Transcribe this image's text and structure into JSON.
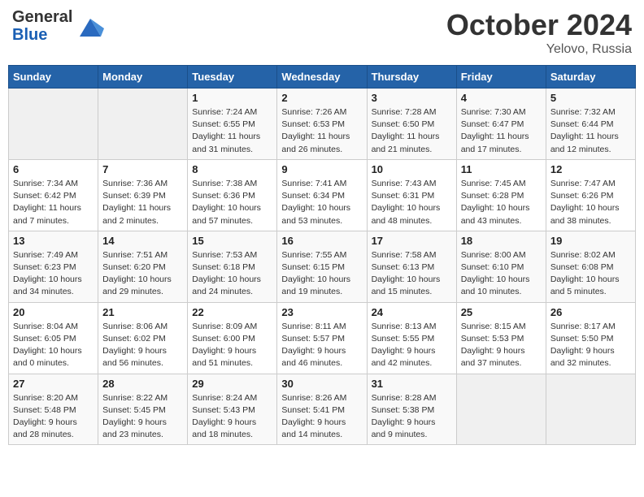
{
  "logo": {
    "line1": "General",
    "line2": "Blue"
  },
  "title": "October 2024",
  "subtitle": "Yelovo, Russia",
  "weekdays": [
    "Sunday",
    "Monday",
    "Tuesday",
    "Wednesday",
    "Thursday",
    "Friday",
    "Saturday"
  ],
  "weeks": [
    [
      {
        "day": "",
        "sunrise": "",
        "sunset": "",
        "daylight": ""
      },
      {
        "day": "",
        "sunrise": "",
        "sunset": "",
        "daylight": ""
      },
      {
        "day": "1",
        "sunrise": "Sunrise: 7:24 AM",
        "sunset": "Sunset: 6:55 PM",
        "daylight": "Daylight: 11 hours and 31 minutes."
      },
      {
        "day": "2",
        "sunrise": "Sunrise: 7:26 AM",
        "sunset": "Sunset: 6:53 PM",
        "daylight": "Daylight: 11 hours and 26 minutes."
      },
      {
        "day": "3",
        "sunrise": "Sunrise: 7:28 AM",
        "sunset": "Sunset: 6:50 PM",
        "daylight": "Daylight: 11 hours and 21 minutes."
      },
      {
        "day": "4",
        "sunrise": "Sunrise: 7:30 AM",
        "sunset": "Sunset: 6:47 PM",
        "daylight": "Daylight: 11 hours and 17 minutes."
      },
      {
        "day": "5",
        "sunrise": "Sunrise: 7:32 AM",
        "sunset": "Sunset: 6:44 PM",
        "daylight": "Daylight: 11 hours and 12 minutes."
      }
    ],
    [
      {
        "day": "6",
        "sunrise": "Sunrise: 7:34 AM",
        "sunset": "Sunset: 6:42 PM",
        "daylight": "Daylight: 11 hours and 7 minutes."
      },
      {
        "day": "7",
        "sunrise": "Sunrise: 7:36 AM",
        "sunset": "Sunset: 6:39 PM",
        "daylight": "Daylight: 11 hours and 2 minutes."
      },
      {
        "day": "8",
        "sunrise": "Sunrise: 7:38 AM",
        "sunset": "Sunset: 6:36 PM",
        "daylight": "Daylight: 10 hours and 57 minutes."
      },
      {
        "day": "9",
        "sunrise": "Sunrise: 7:41 AM",
        "sunset": "Sunset: 6:34 PM",
        "daylight": "Daylight: 10 hours and 53 minutes."
      },
      {
        "day": "10",
        "sunrise": "Sunrise: 7:43 AM",
        "sunset": "Sunset: 6:31 PM",
        "daylight": "Daylight: 10 hours and 48 minutes."
      },
      {
        "day": "11",
        "sunrise": "Sunrise: 7:45 AM",
        "sunset": "Sunset: 6:28 PM",
        "daylight": "Daylight: 10 hours and 43 minutes."
      },
      {
        "day": "12",
        "sunrise": "Sunrise: 7:47 AM",
        "sunset": "Sunset: 6:26 PM",
        "daylight": "Daylight: 10 hours and 38 minutes."
      }
    ],
    [
      {
        "day": "13",
        "sunrise": "Sunrise: 7:49 AM",
        "sunset": "Sunset: 6:23 PM",
        "daylight": "Daylight: 10 hours and 34 minutes."
      },
      {
        "day": "14",
        "sunrise": "Sunrise: 7:51 AM",
        "sunset": "Sunset: 6:20 PM",
        "daylight": "Daylight: 10 hours and 29 minutes."
      },
      {
        "day": "15",
        "sunrise": "Sunrise: 7:53 AM",
        "sunset": "Sunset: 6:18 PM",
        "daylight": "Daylight: 10 hours and 24 minutes."
      },
      {
        "day": "16",
        "sunrise": "Sunrise: 7:55 AM",
        "sunset": "Sunset: 6:15 PM",
        "daylight": "Daylight: 10 hours and 19 minutes."
      },
      {
        "day": "17",
        "sunrise": "Sunrise: 7:58 AM",
        "sunset": "Sunset: 6:13 PM",
        "daylight": "Daylight: 10 hours and 15 minutes."
      },
      {
        "day": "18",
        "sunrise": "Sunrise: 8:00 AM",
        "sunset": "Sunset: 6:10 PM",
        "daylight": "Daylight: 10 hours and 10 minutes."
      },
      {
        "day": "19",
        "sunrise": "Sunrise: 8:02 AM",
        "sunset": "Sunset: 6:08 PM",
        "daylight": "Daylight: 10 hours and 5 minutes."
      }
    ],
    [
      {
        "day": "20",
        "sunrise": "Sunrise: 8:04 AM",
        "sunset": "Sunset: 6:05 PM",
        "daylight": "Daylight: 10 hours and 0 minutes."
      },
      {
        "day": "21",
        "sunrise": "Sunrise: 8:06 AM",
        "sunset": "Sunset: 6:02 PM",
        "daylight": "Daylight: 9 hours and 56 minutes."
      },
      {
        "day": "22",
        "sunrise": "Sunrise: 8:09 AM",
        "sunset": "Sunset: 6:00 PM",
        "daylight": "Daylight: 9 hours and 51 minutes."
      },
      {
        "day": "23",
        "sunrise": "Sunrise: 8:11 AM",
        "sunset": "Sunset: 5:57 PM",
        "daylight": "Daylight: 9 hours and 46 minutes."
      },
      {
        "day": "24",
        "sunrise": "Sunrise: 8:13 AM",
        "sunset": "Sunset: 5:55 PM",
        "daylight": "Daylight: 9 hours and 42 minutes."
      },
      {
        "day": "25",
        "sunrise": "Sunrise: 8:15 AM",
        "sunset": "Sunset: 5:53 PM",
        "daylight": "Daylight: 9 hours and 37 minutes."
      },
      {
        "day": "26",
        "sunrise": "Sunrise: 8:17 AM",
        "sunset": "Sunset: 5:50 PM",
        "daylight": "Daylight: 9 hours and 32 minutes."
      }
    ],
    [
      {
        "day": "27",
        "sunrise": "Sunrise: 8:20 AM",
        "sunset": "Sunset: 5:48 PM",
        "daylight": "Daylight: 9 hours and 28 minutes."
      },
      {
        "day": "28",
        "sunrise": "Sunrise: 8:22 AM",
        "sunset": "Sunset: 5:45 PM",
        "daylight": "Daylight: 9 hours and 23 minutes."
      },
      {
        "day": "29",
        "sunrise": "Sunrise: 8:24 AM",
        "sunset": "Sunset: 5:43 PM",
        "daylight": "Daylight: 9 hours and 18 minutes."
      },
      {
        "day": "30",
        "sunrise": "Sunrise: 8:26 AM",
        "sunset": "Sunset: 5:41 PM",
        "daylight": "Daylight: 9 hours and 14 minutes."
      },
      {
        "day": "31",
        "sunrise": "Sunrise: 8:28 AM",
        "sunset": "Sunset: 5:38 PM",
        "daylight": "Daylight: 9 hours and 9 minutes."
      },
      {
        "day": "",
        "sunrise": "",
        "sunset": "",
        "daylight": ""
      },
      {
        "day": "",
        "sunrise": "",
        "sunset": "",
        "daylight": ""
      }
    ]
  ]
}
